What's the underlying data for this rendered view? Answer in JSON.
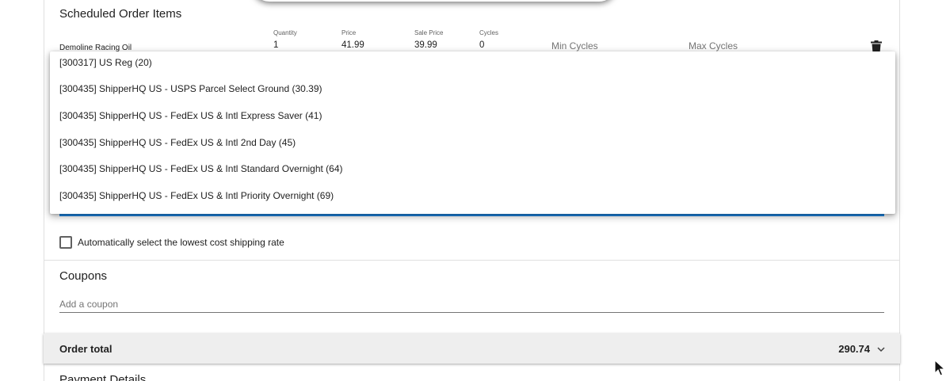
{
  "scheduled_items": {
    "title": "Scheduled Order Items",
    "item": {
      "name": "Demoline Racing Oil",
      "quantity_label": "Quantity",
      "quantity": "1",
      "price_label": "Price",
      "price": "41.99",
      "sale_price_label": "Sale Price",
      "sale_price": "39.99",
      "cycles_label": "Cycles",
      "cycles": "0",
      "min_cycles_placeholder": "Min Cycles",
      "max_cycles_placeholder": "Max Cycles"
    }
  },
  "shipping_dropdown": {
    "options": [
      "[300317] US Reg (20)",
      "[300435] ShipperHQ US - USPS Parcel Select Ground (30.39)",
      "[300435] ShipperHQ US - FedEx US & Intl Express Saver (41)",
      "[300435] ShipperHQ US - FedEx US & Intl 2nd Day (45)",
      "[300435] ShipperHQ US - FedEx US & Intl Standard Overnight (64)",
      "[300435] ShipperHQ US - FedEx US & Intl Priority Overnight (69)"
    ]
  },
  "auto_select": {
    "label": "Automatically select the lowest cost shipping rate",
    "checked": false
  },
  "coupons": {
    "title": "Coupons",
    "placeholder": "Add a coupon"
  },
  "order_total": {
    "label": "Order total",
    "value": "290.74"
  },
  "payment": {
    "title": "Payment Details"
  },
  "colors": {
    "accent": "#1e88e5",
    "total_bar": "#eeeeee"
  },
  "icons": {
    "delete": "trash-icon",
    "expand": "chevron-down-icon",
    "pointer": "mouse-cursor-icon"
  }
}
